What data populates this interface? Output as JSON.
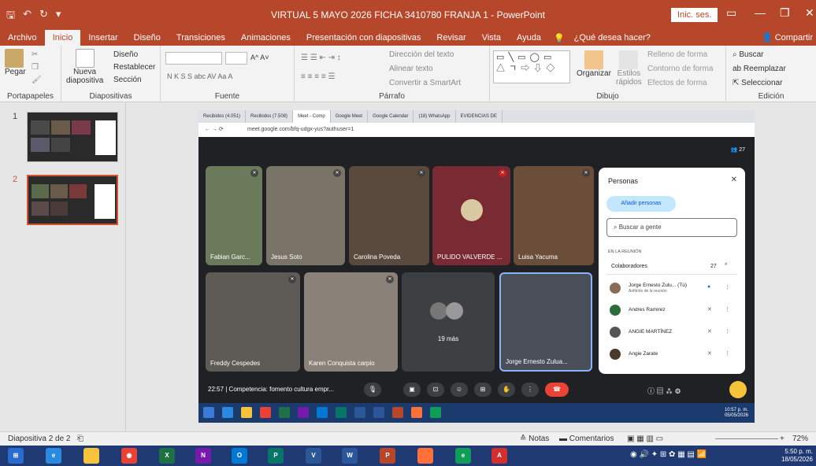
{
  "titlebar": {
    "title": "VIRTUAL 5 MAYO 2026 FICHA 3410780 FRANJA 1  -  PowerPoint",
    "signin": "Inic. ses."
  },
  "tabs": [
    "Archivo",
    "Inicio",
    "Insertar",
    "Diseño",
    "Transiciones",
    "Animaciones",
    "Presentación con diapositivas",
    "Revisar",
    "Vista",
    "Ayuda"
  ],
  "tellme": "¿Qué desea hacer?",
  "share": "Compartir",
  "ribbon": {
    "paste": "Pegar",
    "new_slide_1": "Nueva",
    "new_slide_2": "diapositiva",
    "layout": "Diseño",
    "reset": "Restablecer",
    "section": "Sección",
    "text_direction": "Dirección del texto",
    "align_text": "Alinear texto",
    "convert_smartart": "Convertir a SmartArt",
    "arrange": "Organizar",
    "quick_styles_1": "Estilos",
    "quick_styles_2": "rápidos",
    "shape_fill": "Relleno de forma",
    "shape_outline": "Contorno de forma",
    "shape_effects": "Efectos de forma",
    "find": "Buscar",
    "replace": "Reemplazar",
    "select": "Seleccionar",
    "font_sample_1": "A^ A˅",
    "font_sample_2": "N K S S abc AV Aa A",
    "group_labels": {
      "clipboard": "Portapapeles",
      "slides": "Diapositivas",
      "font": "Fuente",
      "paragraph": "Párrafo",
      "drawing": "Dibujo",
      "editing": "Edición"
    }
  },
  "slides": [
    {
      "num": "1"
    },
    {
      "num": "2"
    }
  ],
  "browser": {
    "tabs": [
      "Recibidos (4.051)",
      "Recibidos (7.508)",
      "Meet - Comp",
      "Google Meet",
      "Google Calendar",
      "(18) WhatsApp",
      "EVIDENCIAS DE"
    ],
    "url": "meet.google.com/bfq-udgx-yus?authuser=1"
  },
  "meet": {
    "participant_count": "27",
    "tiles": [
      {
        "name": "Fabian Garc..."
      },
      {
        "name": "Jesus Soto"
      },
      {
        "name": "Carolina Poveda"
      },
      {
        "name": "PULIDO VALVERDE ..."
      },
      {
        "name": "Luisa Yacuma"
      },
      {
        "name": "Freddy Cespedes"
      },
      {
        "name": "Karen Conquista carpio"
      },
      {
        "name": "19 más"
      },
      {
        "name": "Jorge Ernesto Zulua..."
      }
    ],
    "people_panel": {
      "title": "Personas",
      "add": "Añadir personas",
      "search": "Buscar a gente",
      "in_meeting": "EN LA REUNIÓN",
      "collaborators": "Colaboradores",
      "collab_count": "27",
      "list": [
        {
          "name": "Jorge Ernesto Zulu... (Tú)",
          "sub": "Anfitrión de la reunión"
        },
        {
          "name": "Andres Ramirez"
        },
        {
          "name": "ANGIE MARTÍNEZ"
        },
        {
          "name": "Angie Zarate"
        }
      ]
    },
    "bottom_text": "22:57  |  Competencia: fomento cultura empr...",
    "mini_time": "10:57 p. m.",
    "mini_date": "05/05/2026"
  },
  "statusbar": {
    "slide_info": "Diapositiva 2 de 2",
    "notes": "Notas",
    "comments": "Comentarios",
    "zoom": "72%"
  },
  "taskbar": {
    "time": "5:50 p. m.",
    "date": "18/05/2026"
  },
  "colors": {
    "powerpoint": "#b7472a",
    "selected_slide": "#d35230",
    "meet_dark": "#202124",
    "hangup": "#ea4335"
  }
}
